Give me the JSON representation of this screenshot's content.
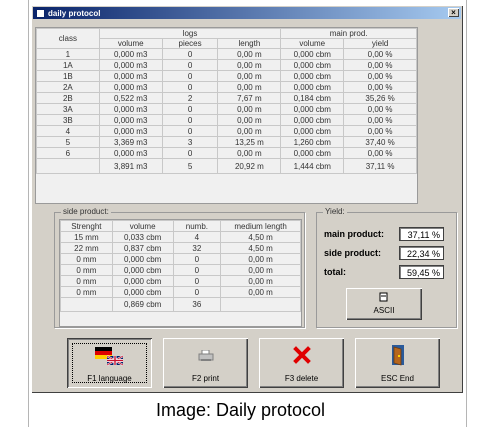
{
  "window": {
    "title": "daily protocol",
    "close_label": "×"
  },
  "logs_table": {
    "group_headers": {
      "class": "class",
      "logs": "logs",
      "main": "main prod."
    },
    "sub_headers": [
      "volume",
      "pieces",
      "length",
      "volume",
      "yield"
    ],
    "rows": [
      [
        "1",
        "0,000 m3",
        "0",
        "0,00 m",
        "0,000 cbm",
        "0,00 %"
      ],
      [
        "1A",
        "0,000 m3",
        "0",
        "0,00 m",
        "0,000 cbm",
        "0,00 %"
      ],
      [
        "1B",
        "0,000 m3",
        "0",
        "0,00 m",
        "0,000 cbm",
        "0,00 %"
      ],
      [
        "2A",
        "0,000 m3",
        "0",
        "0,00 m",
        "0,000 cbm",
        "0,00 %"
      ],
      [
        "2B",
        "0,522 m3",
        "2",
        "7,67 m",
        "0,184 cbm",
        "35,26 %"
      ],
      [
        "3A",
        "0,000 m3",
        "0",
        "0,00 m",
        "0,000 cbm",
        "0,00 %"
      ],
      [
        "3B",
        "0,000 m3",
        "0",
        "0,00 m",
        "0,000 cbm",
        "0,00 %"
      ],
      [
        "4",
        "0,000 m3",
        "0",
        "0,00 m",
        "0,000 cbm",
        "0,00 %"
      ],
      [
        "5",
        "3,369 m3",
        "3",
        "13,25 m",
        "1,260 cbm",
        "37,40 %"
      ],
      [
        "6",
        "0,000 m3",
        "0",
        "0,00 m",
        "0,000 cbm",
        "0,00 %"
      ]
    ],
    "total": [
      "",
      "3,891 m3",
      "5",
      "20,92 m",
      "1,444 cbm",
      "37,11 %"
    ]
  },
  "side_product": {
    "title": "side product:",
    "headers": [
      "Strenght",
      "volume",
      "numb.",
      "medium length"
    ],
    "rows": [
      [
        "15 mm",
        "0,033 cbm",
        "4",
        "4,50 m"
      ],
      [
        "22 mm",
        "0,837 cbm",
        "32",
        "4,50 m"
      ],
      [
        "0 mm",
        "0,000 cbm",
        "0",
        "0,00 m"
      ],
      [
        "0 mm",
        "0,000 cbm",
        "0",
        "0,00 m"
      ],
      [
        "0 mm",
        "0,000 cbm",
        "0",
        "0,00 m"
      ],
      [
        "0 mm",
        "0,000 cbm",
        "0",
        "0,00 m"
      ]
    ],
    "total": [
      "",
      "0,869 cbm",
      "36",
      ""
    ]
  },
  "yield": {
    "title": "Yield:",
    "main_label": "main product:",
    "main_value": "37,11 %",
    "side_label": "side product:",
    "side_value": "22,34 %",
    "total_label": "total:",
    "total_value": "59,45 %",
    "ascii_label": "ASCII"
  },
  "buttons": {
    "language": "F1 language",
    "print": "F2 print",
    "delete": "F3 delete",
    "end": "ESC End"
  },
  "caption": "Image: Daily protocol"
}
